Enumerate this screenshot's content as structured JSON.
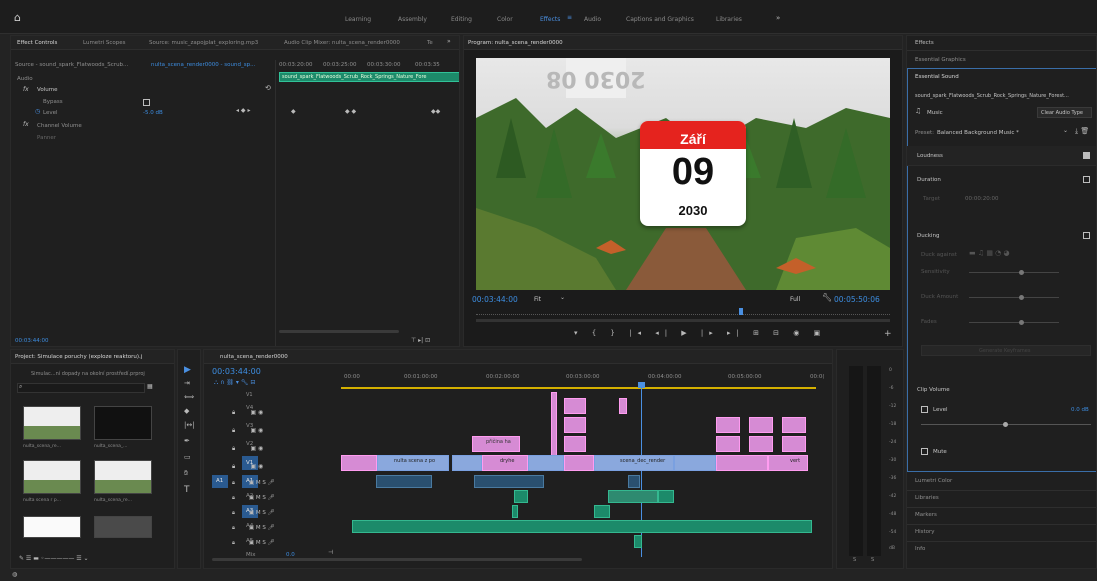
{
  "workspaces": [
    "Learning",
    "Assembly",
    "Editing",
    "Color",
    "Effects",
    "Audio",
    "Captions and Graphics",
    "Libraries"
  ],
  "workspace_active": "Effects",
  "source_panel": {
    "tabs": [
      "Effect Controls",
      "Lumetri Scopes",
      "Source: music_zapojplat_exploring.mp3",
      "Audio Clip Mixer: nulta_scena_render0000",
      "Te"
    ],
    "source_line": "Source - sound_spark_Flatwoods_Scrub...",
    "sequence_link": "nulta_scena_render0000 - sound_sp...",
    "times": [
      "00:03:20:00",
      "00:03:25:00",
      "00:03:30:00",
      "00:03:35"
    ],
    "clip_label": "sound_spark_Flatwoods_Scrub_Rock_Springs_Nature_Fore",
    "audio_label": "Audio",
    "fx_volume": "Volume",
    "bypass": "Bypass",
    "level": "Level",
    "level_value": "-5.0 dB",
    "channel_volume": "Channel Volume",
    "panner": "Panner",
    "timecode": "00:03:44:00"
  },
  "program": {
    "title": "Program: nulta_scena_render0000",
    "timecode": "00:03:44:00",
    "fit": "Fit",
    "quality": "Full",
    "duration": "00:05:50:06",
    "calendar_month": "Září",
    "calendar_day": "09",
    "calendar_year": "2030",
    "bg_text": "2030  08"
  },
  "project": {
    "title": "Project: Simulace poruchy (exploze reaktoru).j",
    "path": "Simulac...ní dopady na okolní prostředí.prproj",
    "items": [
      "nulta_scena_re...",
      "nulta_scena_...",
      "nulta scena r p...",
      "nulta_scena_re...",
      "",
      ""
    ]
  },
  "timeline": {
    "title": "nulta_scena_render0000",
    "timecode": "00:03:44:00",
    "ruler": [
      "00:00",
      "00:01:00:00",
      "00:02:00:00",
      "00:03:00:00",
      "00:04:00:00",
      "00:05:00:00",
      "00:0("
    ],
    "video_tracks": [
      "V4",
      "V3",
      "V2",
      "V1"
    ],
    "audio_tracks": [
      "A1",
      "A2",
      "A3",
      "A4",
      "A5"
    ],
    "mix_label": "Mix",
    "mix_value": "0.0",
    "clip_labels": [
      "nulta scena z po",
      "dryhe",
      "scena_dec_render",
      "vert",
      "přičina ha"
    ],
    "v_top_label": "V1"
  },
  "meter_scale": [
    "0",
    "-6",
    "-12",
    "-18",
    "-24",
    "-30",
    "-36",
    "-42",
    "-48",
    "-54",
    "dB"
  ],
  "meter_solo": [
    "S",
    "S"
  ],
  "essential_sound": {
    "panels": [
      "Effects",
      "Essential Graphics",
      "Essential Sound"
    ],
    "clip_name": "sound_spark_Flatwoods_Scrub_Rock_Springs_Nature_Forest...",
    "type": "Music",
    "clear_label": "Clear Audio Type",
    "preset_label": "Preset:",
    "preset_value": "Balanced Background Music *",
    "loudness": "Loudness",
    "duration": "Duration",
    "target_label": "Target",
    "target_value": "00:00:20:00",
    "ducking": "Ducking",
    "duck_against": "Duck against",
    "sensitivity": "Sensitivity",
    "duck_amount": "Duck Amount",
    "fades": "Fades",
    "generate_label": "Generate Keyframes",
    "clip_volume": "Clip Volume",
    "level": "Level",
    "level_value": "0.0 dB",
    "mute": "Mute",
    "bottom_panels": [
      "Lumetri Color",
      "Libraries",
      "Markers",
      "History",
      "Info"
    ]
  }
}
